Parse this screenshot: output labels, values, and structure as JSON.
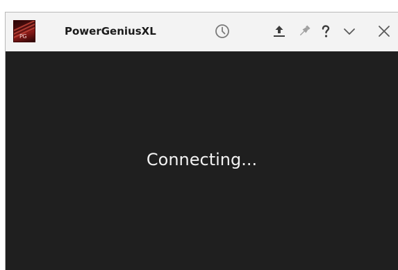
{
  "window": {
    "title": "PowerGeniusXL",
    "icon": {
      "name": "powergenius-logo",
      "text": "PG"
    },
    "titlebar_buttons": [
      {
        "name": "history-icon"
      },
      {
        "name": "upload-icon"
      },
      {
        "name": "pin-icon"
      },
      {
        "name": "help-icon",
        "glyph": "?"
      },
      {
        "name": "minimize-chevron-icon"
      },
      {
        "name": "close-icon"
      }
    ]
  },
  "content": {
    "status_text": "Connecting..."
  },
  "colors": {
    "titlebar_bg": "#f3f3f3",
    "content_bg": "#1f1f1f",
    "status_text": "#f2f2f2",
    "icon_gray": "#7a7a7a",
    "icon_dark": "#3c3c3c"
  }
}
